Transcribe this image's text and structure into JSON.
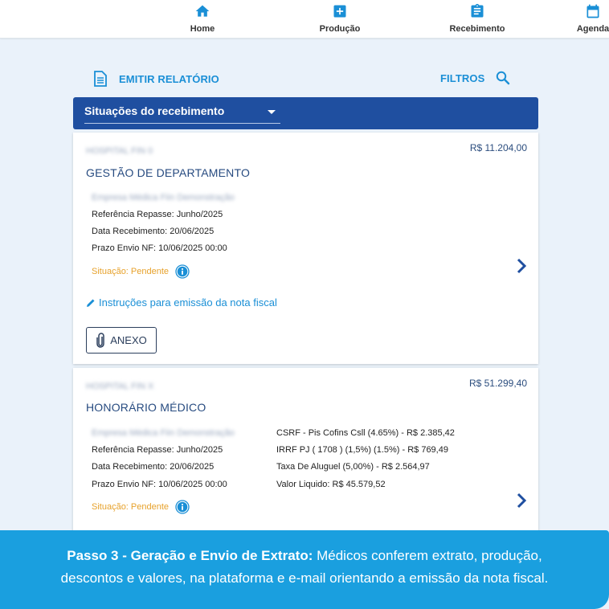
{
  "nav": {
    "items": [
      {
        "label": "Home",
        "icon": "home-icon"
      },
      {
        "label": "Produção",
        "icon": "plus-box-icon"
      },
      {
        "label": "Recebimento",
        "icon": "clipboard-icon"
      },
      {
        "label": "Agenda",
        "icon": "calendar-icon"
      }
    ]
  },
  "actions": {
    "emit_label": "EMITIR RELATÓRIO",
    "filters_label": "FILTROS"
  },
  "filter_select": {
    "value": "Situações do recebimento"
  },
  "cards": [
    {
      "hospital": "HOSPITAL FIN 0",
      "amount": "R$ 11.204,00",
      "title": "GESTÃO DE DEPARTAMENTO",
      "company": "Empresa Médica Fiin Demonstração",
      "referencia": "Referência Repasse: Junho/2025",
      "data_recebimento": "Data Recebimento: 20/06/2025",
      "prazo": "Prazo Envio NF: 10/06/2025 00:00",
      "situacao": "Situação: Pendente",
      "instructions": "Instruções para emissão da nota fiscal",
      "attachment_label": "ANEXO"
    },
    {
      "hospital": "HOSPITAL FIN X",
      "amount": "R$ 51.299,40",
      "title": "HONORÁRIO MÉDICO",
      "company": "Empresa Médica Fiin Demonstração",
      "referencia": "Referência Repasse: Junho/2025",
      "data_recebimento": "Data Recebimento: 20/06/2025",
      "prazo": "Prazo Envio NF: 10/06/2025 00:00",
      "situacao": "Situação: Pendente",
      "deductions": [
        "CSRF - Pis Cofins Csll (4.65%)   -   R$ 2.385,42",
        "IRRF PJ ( 1708 ) (1,5%) (1.5%)   -   R$ 769,49",
        "Taxa De Aluguel (5,00%)   -   R$ 2.564,97",
        "Valor Liquido:     R$ 45.579,52"
      ]
    }
  ],
  "banner": {
    "bold": "Passo 3 - Geração e Envio de Extrato:",
    "text1": " Médicos conferem extrato, produção,",
    "text2": "descontos e valores, na plataforma e e-mail orientando a emissão da nota fiscal."
  },
  "colors": {
    "primary": "#1f4fa0",
    "accent": "#1a8fd6",
    "pending": "#e7a22c",
    "banner": "#1a9fdf"
  }
}
